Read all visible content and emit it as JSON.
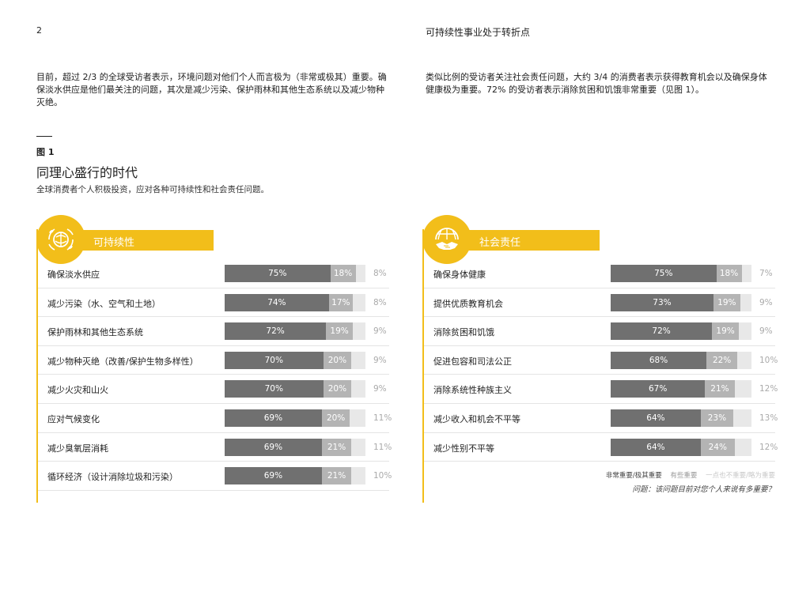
{
  "page_number": "2",
  "running_head": "可持续性事业处于转折点",
  "intro_left": "目前，超过 2/3 的全球受访者表示，环境问题对他们个人而言极为（非常或极其）重要。确保淡水供应是他们最关注的问题，其次是减少污染、保护雨林和其他生态系统以及减少物种灭绝。",
  "intro_right": "类似比例的受访者关注社会责任问题，大约 3/4 的消费者表示获得教育机会以及确保身体健康极为重要。72% 的受访者表示消除贫困和饥饿非常重要（见图 1）。",
  "figure": {
    "label": "图 1",
    "title": "同理心盛行的时代",
    "subtitle": "全球消费者个人积极投资，应对各种可持续性和社会责任问题。"
  },
  "colors": {
    "accent": "#f2be1a",
    "very_important": "#707070",
    "somewhat_important": "#b4b4b4",
    "not_important": "#e8e8e8"
  },
  "icons": {
    "sustainability": "globe-leaves-icon",
    "social": "globe-handshake-icon"
  },
  "chart_data": [
    {
      "type": "bar",
      "stacked": true,
      "orientation": "horizontal",
      "title": "可持续性",
      "categories": [
        "确保淡水供应",
        "减少污染（水、空气和土地）",
        "保护雨林和其他生态系统",
        "减少物种灭绝（改善/保护生物多样性）",
        "减少火灾和山火",
        "应对气候变化",
        "减少臭氧层消耗",
        "循环经济（设计消除垃圾和污染）"
      ],
      "series": [
        {
          "name": "非常重要/极其重要",
          "values": [
            75,
            74,
            72,
            70,
            70,
            69,
            69,
            69
          ]
        },
        {
          "name": "有些重要",
          "values": [
            18,
            17,
            19,
            20,
            20,
            20,
            21,
            21
          ]
        },
        {
          "name": "一点也不重要/略为重要",
          "values": [
            8,
            8,
            9,
            9,
            9,
            11,
            11,
            10
          ]
        }
      ],
      "xlim": [
        0,
        100
      ]
    },
    {
      "type": "bar",
      "stacked": true,
      "orientation": "horizontal",
      "title": "社会责任",
      "categories": [
        "确保身体健康",
        "提供优质教育机会",
        "消除贫困和饥饿",
        "促进包容和司法公正",
        "消除系统性种族主义",
        "减少收入和机会不平等",
        "减少性别不平等"
      ],
      "series": [
        {
          "name": "非常重要/极其重要",
          "values": [
            75,
            73,
            72,
            68,
            67,
            64,
            64
          ]
        },
        {
          "name": "有些重要",
          "values": [
            18,
            19,
            19,
            22,
            21,
            23,
            24
          ]
        },
        {
          "name": "一点也不重要/略为重要",
          "values": [
            7,
            9,
            9,
            10,
            12,
            13,
            12
          ]
        }
      ],
      "xlim": [
        0,
        100
      ]
    }
  ],
  "legend": [
    "非常重要/极其重要",
    "有些重要",
    "一点也不重要/略为重要"
  ],
  "question": "问题：该问题目前对您个人来说有多重要？"
}
